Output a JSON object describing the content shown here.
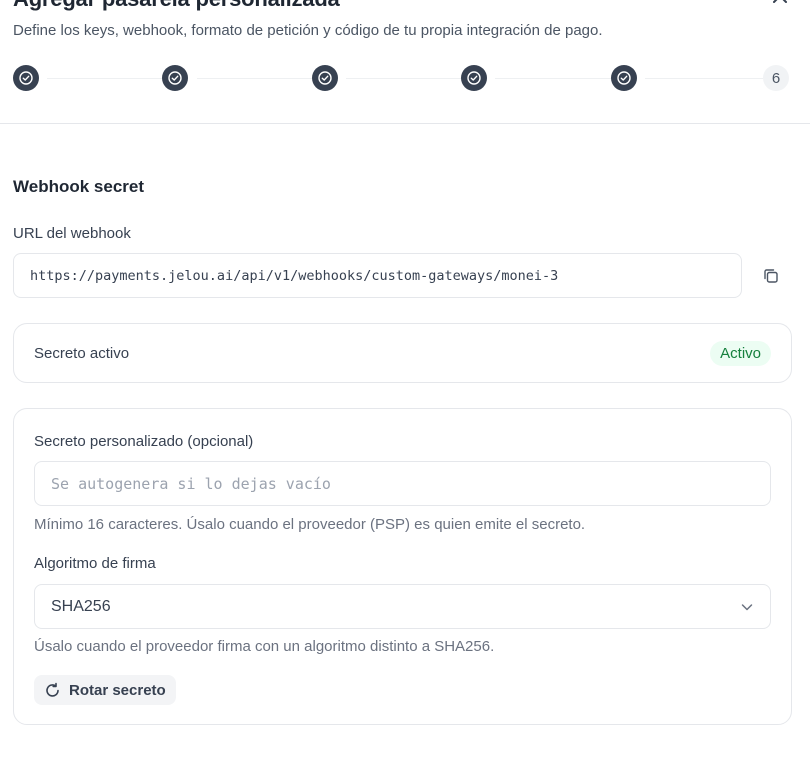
{
  "header": {
    "title": "Agregar pasarela personalizada",
    "subtitle": "Define los keys, webhook, formato de petición y código de tu propia integración de pago."
  },
  "stepper": {
    "completed_icon": "check-circle-icon",
    "current_step": "6"
  },
  "webhook": {
    "section_title": "Webhook secret",
    "url_label": "URL del webhook",
    "url_value": "https://payments.jelou.ai/api/v1/webhooks/custom-gateways/monei-3"
  },
  "secret_status": {
    "label": "Secreto activo",
    "badge": "Activo"
  },
  "custom_secret": {
    "label": "Secreto personalizado (opcional)",
    "placeholder": "Se autogenera si lo dejas vacío",
    "help": "Mínimo 16 caracteres. Úsalo cuando el proveedor (PSP) es quien emite el secreto."
  },
  "algorithm": {
    "label": "Algoritmo de firma",
    "selected": "SHA256",
    "help": "Úsalo cuando el proveedor firma con un algoritmo distinto a SHA256."
  },
  "actions": {
    "rotate_label": "Rotar secreto"
  },
  "colors": {
    "step_done": "#374151",
    "badge_bg": "#ecfdf3",
    "badge_text": "#15803d"
  }
}
